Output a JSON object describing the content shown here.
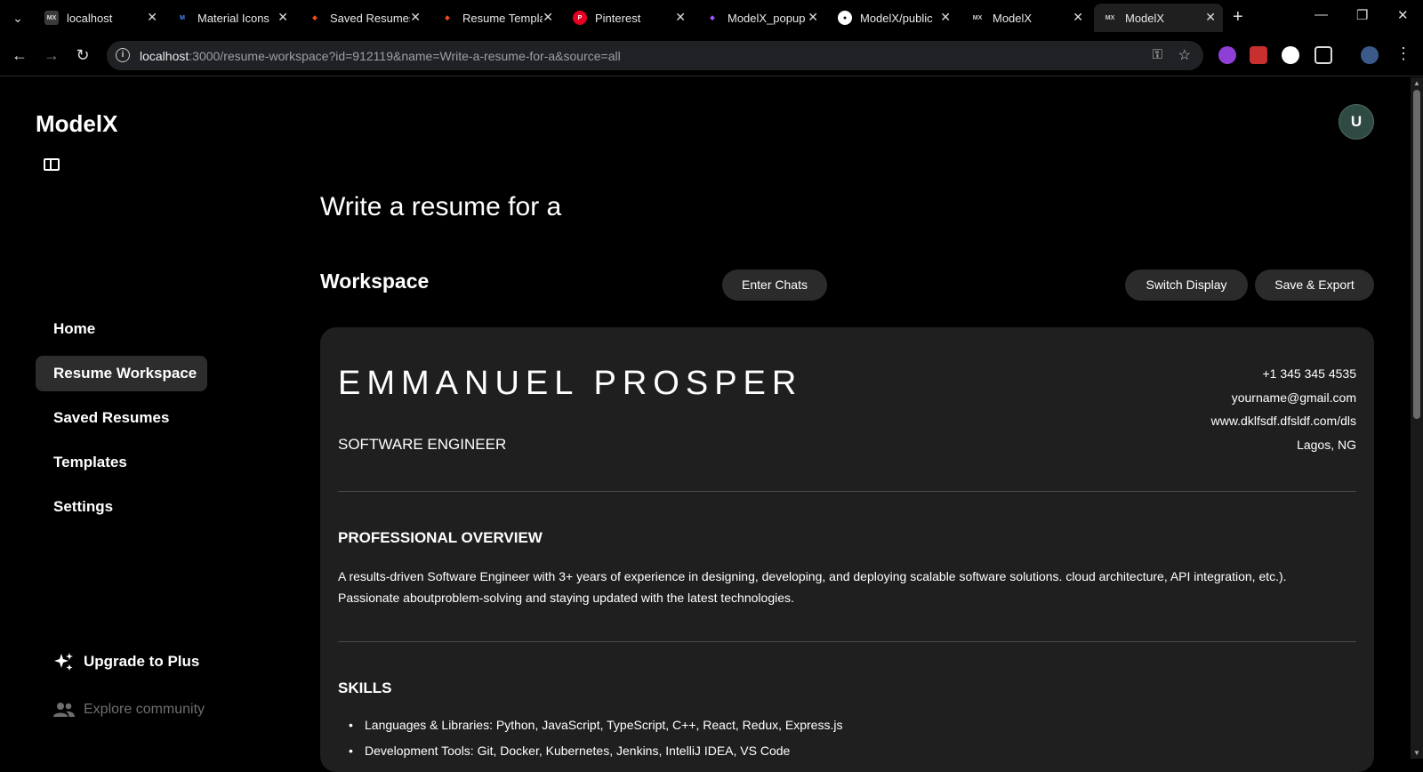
{
  "browser": {
    "tabs": [
      {
        "title": "localhost",
        "favicon": "modelx",
        "fav_bg": "#3a3a3a",
        "fav_color": "#ddd",
        "fav_text": "MX"
      },
      {
        "title": "Material Icons",
        "favicon": "material",
        "fav_bg": "#000",
        "fav_color": "#4a8cff",
        "fav_text": "M"
      },
      {
        "title": "Saved Resumes",
        "favicon": "figma",
        "fav_bg": "#000",
        "fav_color": "#f24e1e",
        "fav_text": "◆"
      },
      {
        "title": "Resume Templates",
        "favicon": "figma",
        "fav_bg": "#000",
        "fav_color": "#f24e1e",
        "fav_text": "◆"
      },
      {
        "title": "Pinterest",
        "favicon": "pinterest",
        "fav_bg": "#e60023",
        "fav_color": "#fff",
        "fav_text": "P"
      },
      {
        "title": "ModelX_popup",
        "favicon": "figma",
        "fav_bg": "#000",
        "fav_color": "#a259ff",
        "fav_text": "◆"
      },
      {
        "title": "ModelX/public",
        "favicon": "github",
        "fav_bg": "#fff",
        "fav_color": "#000",
        "fav_text": "●"
      },
      {
        "title": "ModelX",
        "favicon": "modelx",
        "fav_bg": "#000",
        "fav_color": "#ccc",
        "fav_text": "MX"
      },
      {
        "title": "ModelX",
        "favicon": "modelx",
        "fav_bg": "#000",
        "fav_color": "#ccc",
        "fav_text": "MX"
      }
    ],
    "url_host": "localhost",
    "url_rest": ":3000/resume-workspace?id=912119&name=Write-a-resume-for-a&source=all"
  },
  "app": {
    "brand": "ModelX",
    "avatar_initial": "U",
    "nav": [
      {
        "label": "Home",
        "active": false
      },
      {
        "label": "Resume Workspace",
        "active": true
      },
      {
        "label": "Saved Resumes",
        "active": false
      },
      {
        "label": "Templates",
        "active": false
      },
      {
        "label": "Settings",
        "active": false
      }
    ],
    "upgrade_label": "Upgrade to Plus",
    "explore_label": "Explore community"
  },
  "main": {
    "page_title": "Write a resume for a",
    "workspace_title": "Workspace",
    "enter_chats": "Enter Chats",
    "switch_display": "Switch Display",
    "save_export": "Save & Export"
  },
  "resume": {
    "name": "EMMANUEL PROSPER",
    "role": "SOFTWARE ENGINEER",
    "phone": "+1 345 345 4535",
    "email": "yourname@gmail.com",
    "website": "www.dklfsdf.dfsldf.com/dls",
    "location": "Lagos, NG",
    "overview_heading": "PROFESSIONAL OVERVIEW",
    "overview_text": "A results-driven Software Engineer with 3+ years of experience in designing, developing, and deploying scalable software solutions. cloud architecture, API integration, etc.). Passionate aboutproblem-solving and staying updated with the latest technologies.",
    "skills_heading": "SKILLS",
    "skills": [
      "Languages & Libraries: Python, JavaScript, TypeScript, C++, React, Redux, Express.js",
      "Development Tools: Git, Docker, Kubernetes, Jenkins, IntelliJ IDEA, VS Code"
    ]
  },
  "colors": {
    "background": "#000000",
    "card": "#1f1f1f",
    "pill": "#2b2b2b",
    "active_nav": "#2d2d2d",
    "avatar": "#2f4a43"
  }
}
